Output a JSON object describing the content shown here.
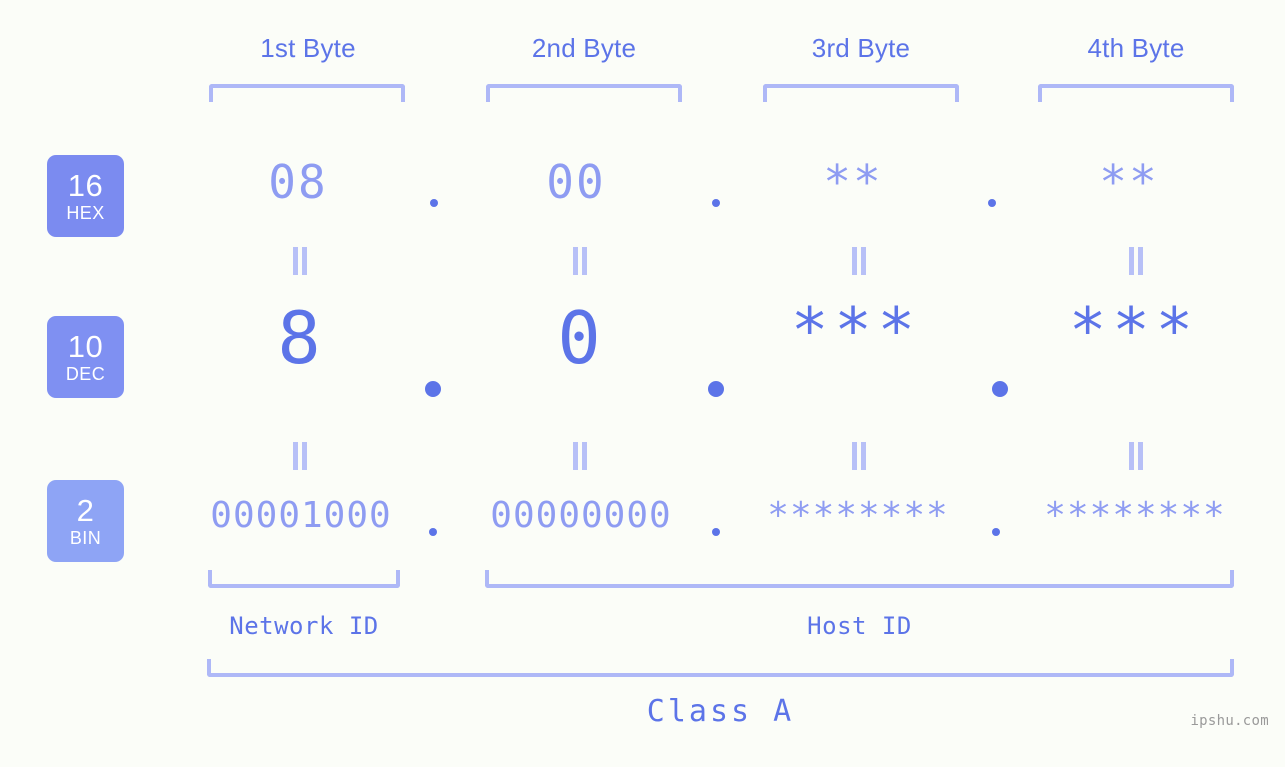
{
  "meta": {
    "background_color": "#fbfdf8",
    "accent_primary": "#5c74e8",
    "accent_light": "#8e9cf2",
    "accent_bracket": "#aeb8f7",
    "badge_color": "#7b8bf0",
    "badge_color_light": "#8ea4f5",
    "watermark": "ipshu.com"
  },
  "byte_headers": [
    {
      "label": "1st Byte"
    },
    {
      "label": "2nd Byte"
    },
    {
      "label": "3rd Byte"
    },
    {
      "label": "4th Byte"
    }
  ],
  "bases": [
    {
      "number": "16",
      "name": "HEX"
    },
    {
      "number": "10",
      "name": "DEC"
    },
    {
      "number": "2",
      "name": "BIN"
    }
  ],
  "rows": {
    "hex": {
      "base_number": "16",
      "base_name": "HEX",
      "values": [
        "08",
        "00",
        "**",
        "**"
      ]
    },
    "dec": {
      "base_number": "10",
      "base_name": "DEC",
      "values": [
        "8",
        "0",
        "***",
        "***"
      ]
    },
    "bin": {
      "base_number": "2",
      "base_name": "BIN",
      "values": [
        "00001000",
        "00000000",
        "********",
        "********"
      ]
    }
  },
  "separators": {
    "hex_dots": [
      ".",
      ".",
      "."
    ],
    "dec_dots": [
      ".",
      ".",
      "."
    ],
    "bin_dots": [
      ".",
      ".",
      "."
    ]
  },
  "equivalence_marks": {
    "hex_to_dec": [
      "=",
      "=",
      "=",
      "="
    ],
    "dec_to_bin": [
      "=",
      "=",
      "=",
      "="
    ]
  },
  "segments": [
    {
      "name": "Network ID",
      "label": "Network ID"
    },
    {
      "name": "Host ID",
      "label": "Host ID"
    }
  ],
  "address_class": {
    "label": "Class A"
  }
}
